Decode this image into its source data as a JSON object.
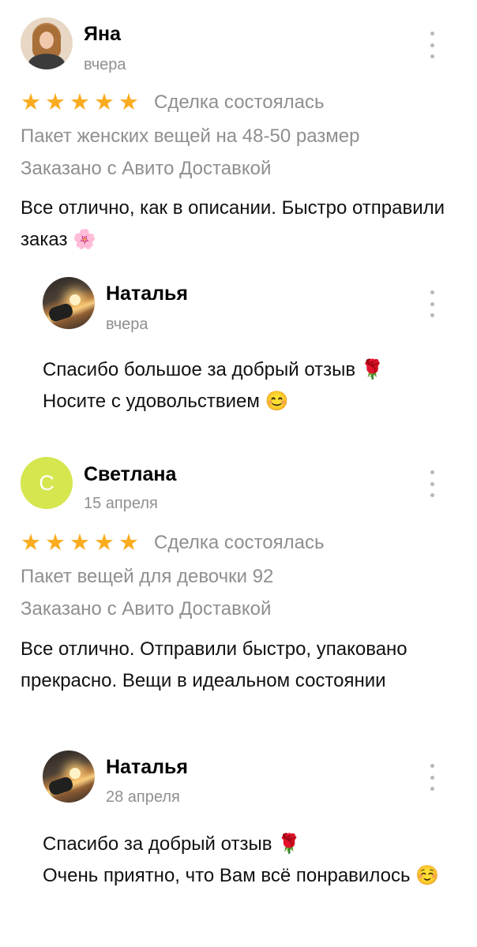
{
  "reviews": [
    {
      "author": "Яна",
      "date": "вчера",
      "stars": 5,
      "deal_status": "Сделка состоялась",
      "item": "Пакет женских вещей на 48-50 размер",
      "delivery": "Заказано с Авито Доставкой",
      "text": "Все отлично, как в описании. Быстро отправили заказ 🌸",
      "reply": {
        "author": "Наталья",
        "date": "вчера",
        "lines": [
          "Спасибо большое за добрый отзыв 🌹",
          "Носите с удовольствием 😊"
        ]
      }
    },
    {
      "author": "Светлана",
      "avatar_initial": "С",
      "date": "15 апреля",
      "stars": 5,
      "deal_status": "Сделка состоялась",
      "item": "Пакет вещей для девочки 92",
      "delivery": "Заказано с Авито Доставкой",
      "text": "Все отлично. Отправили быстро, упаковано прекрасно. Вещи в идеальном состоянии",
      "reply": {
        "author": "Наталья",
        "date": "28 апреля",
        "lines": [
          "Спасибо за добрый отзыв 🌹",
          "Очень приятно, что Вам всё понравилось ☺️"
        ]
      }
    }
  ],
  "icons": {
    "star": "★",
    "more": "more-vertical-icon"
  },
  "colors": {
    "star": "#f9ac1f",
    "muted_text": "#8f8f8f",
    "avatar_initial_bg": "#d5e64f"
  }
}
